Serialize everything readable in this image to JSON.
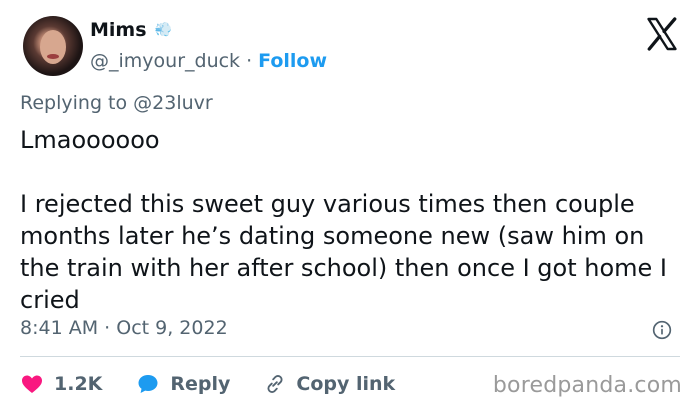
{
  "header": {
    "name": "Mims",
    "name_emoji": "💨",
    "handle": "@_imyour_duck",
    "separator": "·",
    "follow_label": "Follow"
  },
  "replying": {
    "prefix": "Replying to",
    "mention": "@23luvr"
  },
  "tweet": {
    "line1": "Lmaoooooo",
    "paragraph": "I rejected this sweet guy various times then couple months later he’s dating someone new (saw him on the train with her after school) then once I got home I cried"
  },
  "meta": {
    "time": "8:41 AM",
    "separator": "·",
    "date": "Oct 9, 2022"
  },
  "actions": {
    "like_count": "1.2K",
    "reply_label": "Reply",
    "copy_label": "Copy link"
  },
  "watermark": "boredpanda.com",
  "icons": {
    "like": "heart-icon",
    "reply": "reply-bubble-icon",
    "copy": "link-icon",
    "info": "info-icon",
    "brand": "x-logo-icon"
  },
  "colors": {
    "follow": "#1d9bf0",
    "heart": "#f91880",
    "reply_bubble": "#1d9bf0",
    "muted": "#536471"
  }
}
